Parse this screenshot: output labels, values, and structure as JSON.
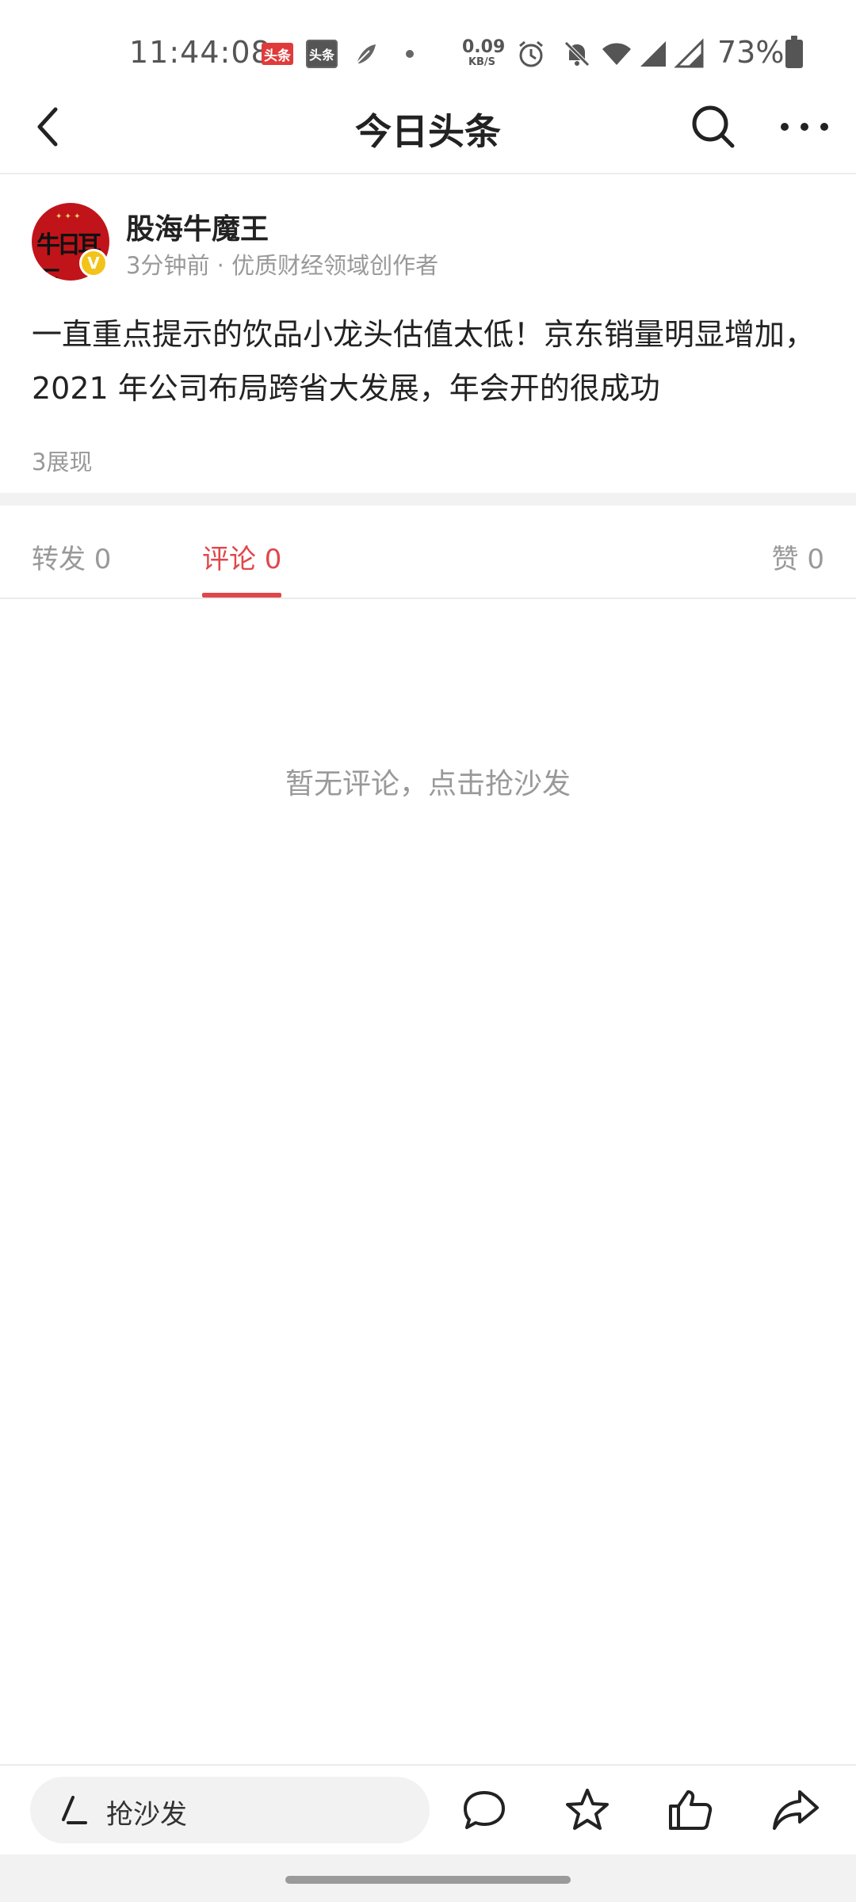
{
  "status_bar": {
    "time": "11:44:08",
    "app_icon_1": "头条",
    "app_icon_2": "头条",
    "net_speed_value": "0.09",
    "net_speed_unit": "KB/S",
    "battery_percent": "73%",
    "icons": [
      "feather-icon",
      "alarm-icon",
      "bell-off-icon",
      "wifi-icon",
      "signal-icon",
      "signal-icon",
      "battery-icon"
    ]
  },
  "header": {
    "title": "今日头条"
  },
  "post": {
    "author_name": "股海牛魔王",
    "author_meta": "3分钟前 · 优质财经领域创作者",
    "verified_badge": "V",
    "text": "一直重点提示的饮品小龙头估值太低！京东销量明显增加，2021 年公司布局跨省大发展，年会开的很成功",
    "impressions": "3展现"
  },
  "tabs": {
    "forward": "转发 0",
    "comment": "评论 0",
    "like": "赞 0",
    "active": "comment"
  },
  "comments": {
    "empty_text": "暂无评论，点击抢沙发"
  },
  "bottom_bar": {
    "input_placeholder": "抢沙发"
  },
  "colors": {
    "accent": "#e0474b",
    "muted_text": "#999999",
    "verified": "#f2c319",
    "avatar_bg": "#c0141a"
  }
}
